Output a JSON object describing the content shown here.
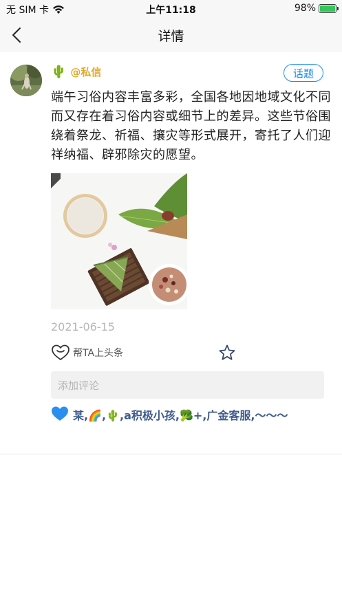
{
  "status_bar": {
    "carrier": "无 SIM 卡",
    "time": "上午11:18",
    "battery": "98%"
  },
  "nav": {
    "title": "详情"
  },
  "post": {
    "user_emoji": "🌵",
    "username": "@私信",
    "topic_button": "话题",
    "content": "端午习俗内容丰富多彩，全国各地因地域文化不同而又存在着习俗内容或细节上的差异。这些节俗围绕着祭龙、祈福、攘灾等形式展开，寄托了人们迎祥纳福、辟邪除灾的愿望。",
    "date": "2021-06-15",
    "like_label": "帮TA上头条",
    "comment_placeholder": "添加评论",
    "likes_text": "某,🌈,🌵,a积极小孩,🥦+,广金客服,～～～"
  },
  "colors": {
    "accent_blue": "#1e8ff0",
    "username_gold": "#e3a92b",
    "likes_blue": "#3f5b8e",
    "battery_green": "#34c759"
  }
}
